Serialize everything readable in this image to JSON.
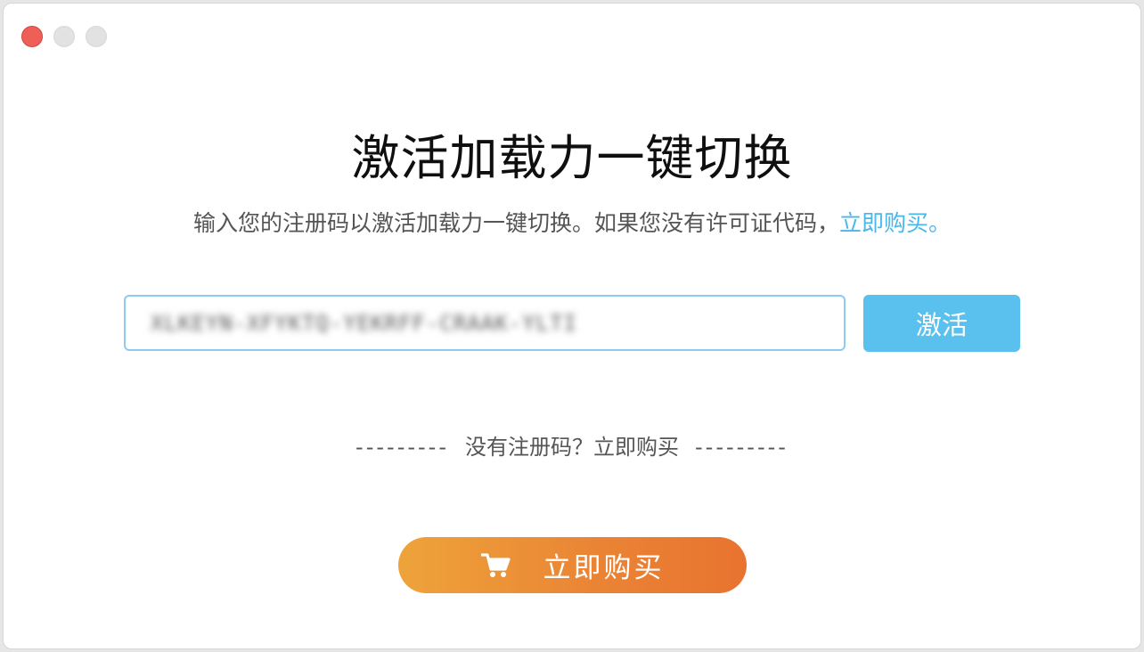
{
  "window": {
    "controls": [
      "close",
      "minimize",
      "maximize"
    ]
  },
  "header": {
    "title": "激活加载力一键切换",
    "subtitle": "输入您的注册码以激活加载力一键切换。如果您没有许可证代码，",
    "subtitle_link": "立即购买。"
  },
  "form": {
    "license_value": "XLKEYN-XFYKTQ-YEKRFF-CRAAK-YLTI",
    "activate_label": "激活"
  },
  "divider": {
    "left_dashes": "---------",
    "text": "没有注册码？立即购买",
    "right_dashes": "---------"
  },
  "buy": {
    "icon": "cart-icon",
    "label": "立即购买"
  },
  "colors": {
    "accent": "#5ac1ee",
    "link": "#4ab7ea",
    "buy_gradient_start": "#eea33a",
    "buy_gradient_end": "#e8732f",
    "close": "#ed5f57"
  }
}
